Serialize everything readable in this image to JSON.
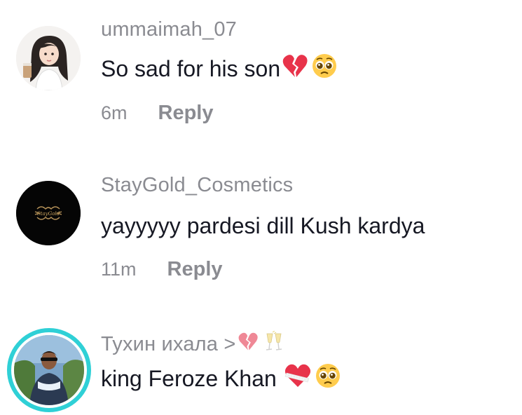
{
  "comments": [
    {
      "username": "ummaimah_07",
      "text": "So sad for his son",
      "emojis": [
        "broken-heart-icon",
        "pleading-face-icon"
      ],
      "time": "6m",
      "reply_label": "Reply"
    },
    {
      "username": "StayGold_Cosmetics",
      "text": "yayyyyy pardesi dill Kush kardya",
      "time": "11m",
      "reply_label": "Reply"
    },
    {
      "username": "Тухин ихала >",
      "username_emojis": [
        "broken-heart-icon",
        "champagne-glasses-icon"
      ],
      "text": "king Feroze Khan",
      "emojis": [
        "mending-heart-icon",
        "pleading-face-icon"
      ]
    }
  ],
  "colors": {
    "username": "#8a8b91",
    "text": "#161823",
    "avatar_ring": "#2fd0d6",
    "heart_red": "#e8334a"
  }
}
